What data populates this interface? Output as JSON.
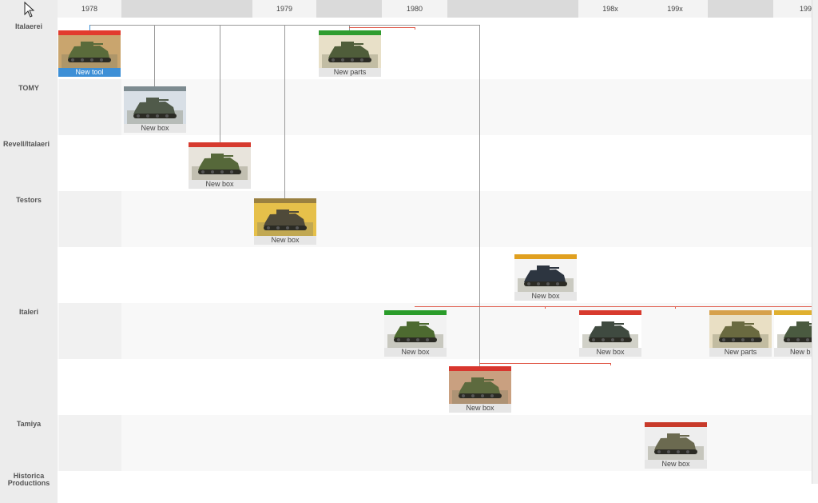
{
  "timeline": {
    "years": [
      "1978",
      "1979",
      "1980",
      "198x",
      "199x",
      "199"
    ]
  },
  "manufacturers": [
    {
      "name": "Italaerei"
    },
    {
      "name": "TOMY"
    },
    {
      "name": "Revell/Italaeri"
    },
    {
      "name": "Testors"
    },
    {
      "name": ""
    },
    {
      "name": "Italeri"
    },
    {
      "name": ""
    },
    {
      "name": "Tamiya"
    },
    {
      "name": "Historica Productions"
    }
  ],
  "releases": [
    {
      "caption": "New tool",
      "selected": true,
      "palette": [
        "#c9a56e",
        "#5a6b3b",
        "#e23b2e"
      ]
    },
    {
      "caption": "New parts",
      "selected": false,
      "palette": [
        "#e8e0c8",
        "#4f5d3a",
        "#2f9c2f"
      ]
    },
    {
      "caption": "New box",
      "selected": false,
      "palette": [
        "#d8dfe6",
        "#505a4a",
        "#7d8b90"
      ]
    },
    {
      "caption": "New box",
      "selected": false,
      "palette": [
        "#e8e4dc",
        "#56683a",
        "#d63a2e"
      ]
    },
    {
      "caption": "New box",
      "selected": false,
      "palette": [
        "#e6c04a",
        "#4f4a3a",
        "#9a8040"
      ]
    },
    {
      "caption": "New box",
      "selected": false,
      "palette": [
        "#f4f4f4",
        "#2d3540",
        "#e0a020"
      ]
    },
    {
      "caption": "New box",
      "selected": false,
      "palette": [
        "#f2f2f2",
        "#4d6a30",
        "#2a9c2a"
      ]
    },
    {
      "caption": "New box",
      "selected": false,
      "palette": [
        "#ffffff",
        "#3f4a40",
        "#d83a2e"
      ]
    },
    {
      "caption": "New parts",
      "selected": false,
      "palette": [
        "#e9dfc4",
        "#6a6a40",
        "#d6a04a"
      ]
    },
    {
      "caption": "New b",
      "selected": false,
      "palette": [
        "#ffffff",
        "#4a5a40",
        "#e0b030"
      ]
    },
    {
      "caption": "New box",
      "selected": false,
      "palette": [
        "#c9a080",
        "#5d6a3e",
        "#d8362e"
      ]
    },
    {
      "caption": "New box",
      "selected": false,
      "palette": [
        "#eeeeee",
        "#6b6a50",
        "#c83a2a"
      ]
    }
  ],
  "colors": {
    "selected": "#3d8fd6",
    "connector": "#999999",
    "link": "#e05a4a"
  }
}
